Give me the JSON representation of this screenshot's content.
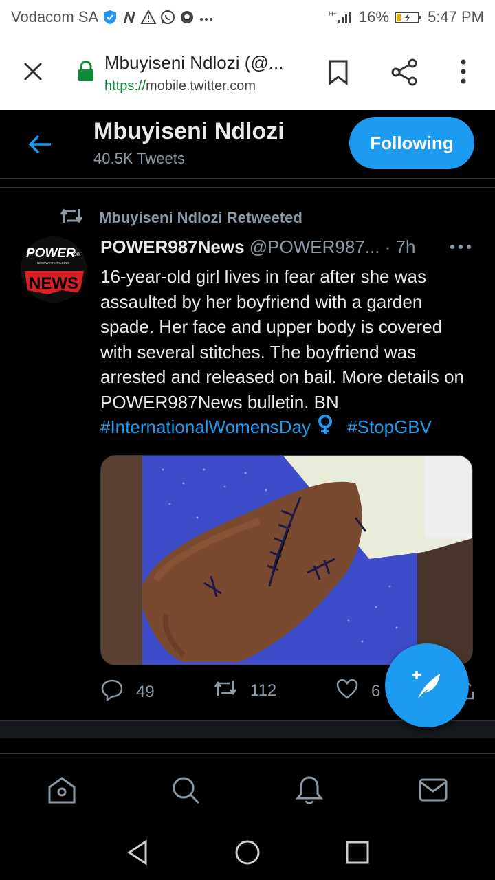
{
  "status_bar": {
    "carrier": "Vodacom SA",
    "battery": "16%",
    "time": "5:47 PM",
    "notification_icons": [
      "shield-icon",
      "nfc-n-icon",
      "warning-icon",
      "whatsapp-icon",
      "soccer-icon",
      "more-dots-icon"
    ],
    "network_label": "H+"
  },
  "browser": {
    "page_title": "Mbuyiseni Ndlozi (@...",
    "url_scheme": "https://",
    "url_host": "mobile.twitter.com"
  },
  "profile_header": {
    "name": "Mbuyiseni Ndlozi",
    "tweet_count": "40.5K Tweets",
    "follow_label": "Following"
  },
  "tweet": {
    "retweeted_by": "Mbuyiseni Ndlozi Retweeted",
    "author": "POWER987News",
    "handle": "@POWER987...",
    "time": "· 7h",
    "text": "16-year-old girl lives in fear after she was assaulted by her boyfriend with a garden spade. Her face and upper body is covered with several stitches. The boyfriend was arrested and released on bail. More details on POWER987News bulletin. BN",
    "hashtag1": "#InternationalWomensDay",
    "hashtag2": "#StopGBV",
    "avatar_logo": {
      "line1": "POWER",
      "sup": "98.7",
      "tag": "NOW WE'RE TALKING",
      "line2": "NEWS"
    },
    "reply_count": "49",
    "retweet_count": "112",
    "like_count": "6"
  },
  "bottom_nav": [
    "home-icon",
    "search-icon",
    "notifications-icon",
    "messages-icon"
  ],
  "colors": {
    "accent": "#1d9bf0",
    "background": "#000000",
    "text_primary": "#e7e9ea",
    "text_secondary": "#8b98a5"
  }
}
